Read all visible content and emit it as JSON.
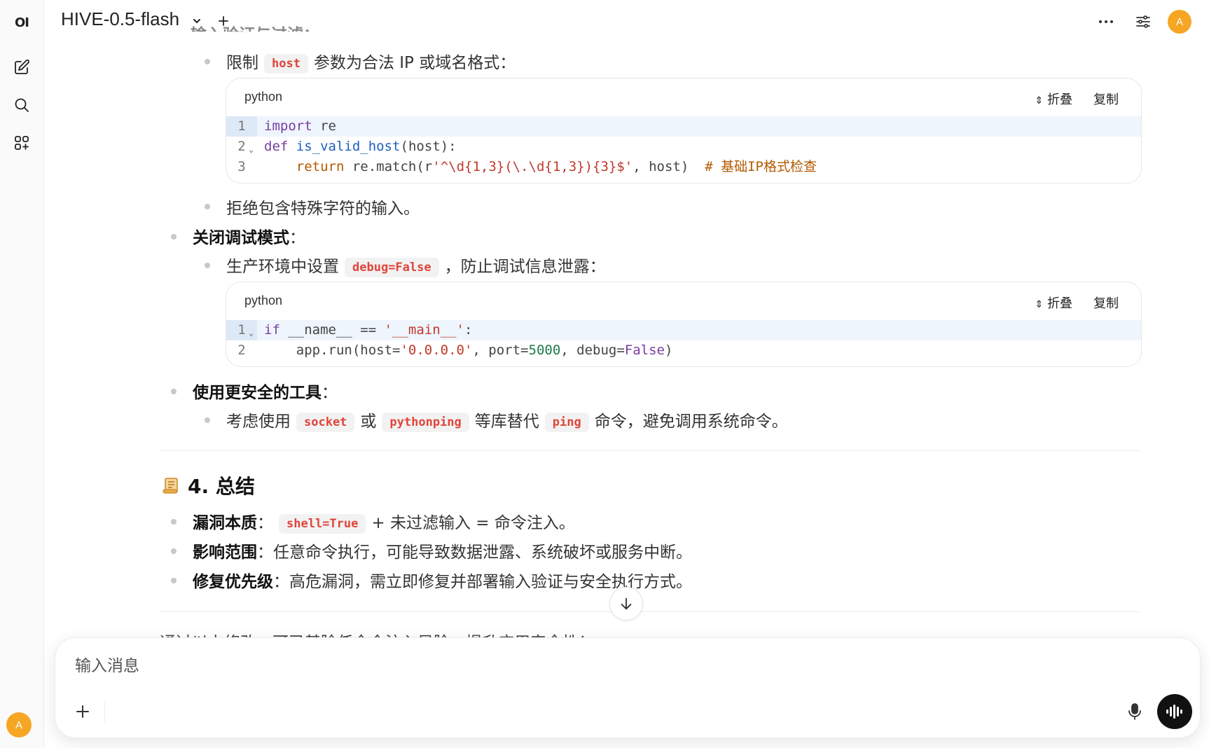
{
  "app": {
    "logo_text": "OI",
    "user_initial": "A"
  },
  "header": {
    "model_name": "HIVE-0.5-flash"
  },
  "content": {
    "top_partial_heading": "输入验证与过滤：",
    "item_limit_host": {
      "prefix": "限制",
      "code": "host",
      "suffix": "参数为合法 IP 或域名格式："
    },
    "codeblock1": {
      "lang": "python",
      "collapse_label": "折叠",
      "copy_label": "复制",
      "lines": [
        "1",
        "2",
        "3"
      ]
    },
    "item_reject": "拒绝包含特殊字符的输入。",
    "heading_debug": "关闭调试模式",
    "colon": "：",
    "item_debug": {
      "prefix": "生产环境中设置",
      "code": "debug=False",
      "suffix": "，防止调试信息泄露："
    },
    "codeblock2": {
      "lang": "python",
      "collapse_label": "折叠",
      "copy_label": "复制",
      "lines": [
        "1",
        "2"
      ]
    },
    "heading_tools": "使用更安全的工具",
    "item_tools": {
      "prefix": "考虑使用",
      "code1": "socket",
      "or": "或",
      "code2": "pythonping",
      "middle": "等库替代",
      "code3": "ping",
      "suffix": "命令，避免调用系统命令。"
    },
    "section_icon": "scroll-icon",
    "section_title": "4. 总结",
    "summary": [
      {
        "label": "漏洞本质",
        "code": "shell=True",
        "text": "+ 未过滤输入 = 命令注入。"
      },
      {
        "label": "影响范围",
        "text": "任意命令执行，可能导致数据泄露、系统破坏或服务中断。"
      },
      {
        "label": "修复优先级",
        "text": "高危漏洞，需立即修复并部署输入验证与安全执行方式。"
      }
    ],
    "bottom_partial": "通过以上修改，可已基除任令令注入风险，提升应用安全性！"
  },
  "composer": {
    "placeholder": "输入消息"
  },
  "colors": {
    "accent": "#f5a623",
    "inline_code": "#e0453a"
  }
}
